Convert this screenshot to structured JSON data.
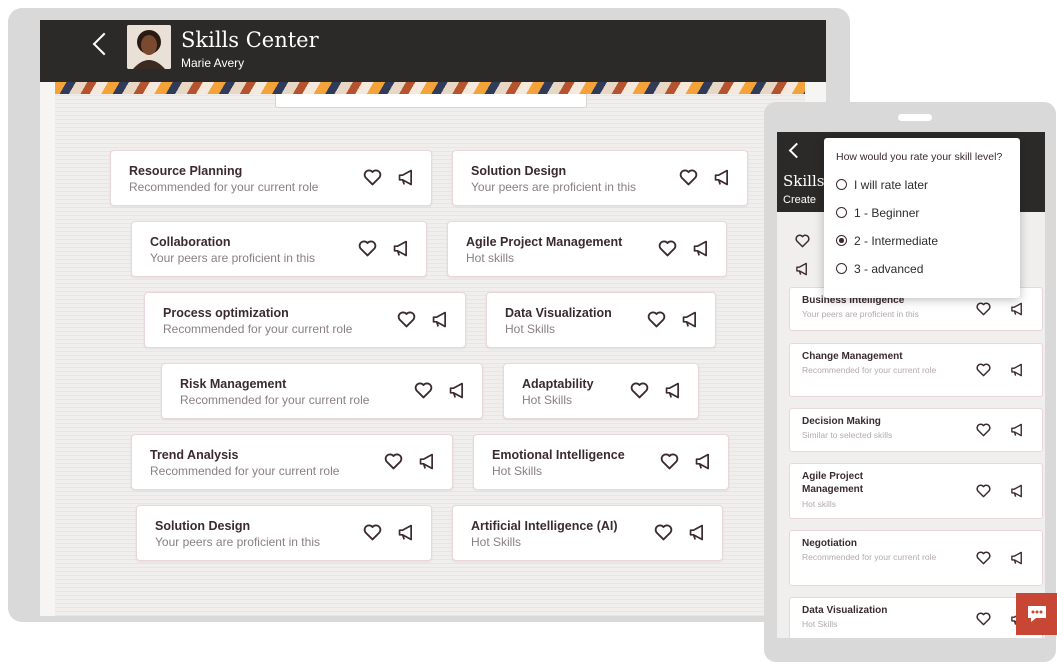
{
  "tablet": {
    "header": {
      "title": "Skills Center",
      "subtitle": "Marie Avery"
    },
    "cards": [
      {
        "name": "Resource Planning",
        "note": "Recommended for your current role"
      },
      {
        "name": "Solution Design",
        "note": "Your peers are proficient in this"
      },
      {
        "name": "Collaboration",
        "note": "Your peers are proficient in this"
      },
      {
        "name": "Agile Project Management",
        "note": "Hot skills"
      },
      {
        "name": "Process optimization",
        "note": "Recommended for your current role"
      },
      {
        "name": "Data Visualization",
        "note": "Hot Skills"
      },
      {
        "name": "Risk Management",
        "note": "Recommended for your current role"
      },
      {
        "name": "Adaptability",
        "note": "Hot Skills"
      },
      {
        "name": "Trend Analysis",
        "note": "Recommended for your current role"
      },
      {
        "name": "Emotional Intelligence",
        "note": "Hot Skills"
      },
      {
        "name": "Solution Design",
        "note": "Your peers are proficient in this"
      },
      {
        "name": "Artificial Intelligence (AI)",
        "note": "Hot Skills"
      }
    ]
  },
  "phone": {
    "header": {
      "title": "Skills",
      "subtitle": "Create"
    },
    "cards": [
      {
        "name": "Business Intelligence",
        "note": "Your peers are proficient in this"
      },
      {
        "name": "Change Management",
        "note": "Recommended for your current role"
      },
      {
        "name": "Decision Making",
        "note": "Similar to selected skills"
      },
      {
        "name": "Agile Project Management",
        "note": "Hot skills"
      },
      {
        "name": "Negotiation",
        "note": "Recommended for your current role"
      },
      {
        "name": "Data Visualization",
        "note": "Hot Skills"
      }
    ],
    "rating_popup": {
      "question": "How would you rate your skill level?",
      "options": [
        "I will rate later",
        "1 - Beginner",
        "2 - Intermediate",
        "3 - advanced"
      ],
      "selected": "2 - Intermediate"
    }
  },
  "icons": {
    "like": "heart-icon",
    "promote": "megaphone-icon",
    "chat": "chat-bubble-icon",
    "back": "chevron-left-icon"
  },
  "colors": {
    "header": "#2c2a29",
    "accent": "#c74634",
    "card_border": "#ead6db"
  }
}
